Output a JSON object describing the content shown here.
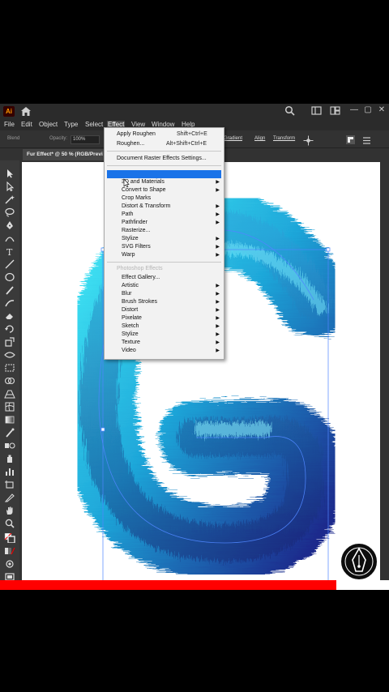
{
  "app": {
    "logo": "Ai",
    "window_controls": [
      "—",
      "▢",
      "✕"
    ]
  },
  "menubar": [
    "File",
    "Edit",
    "Object",
    "Type",
    "Select",
    "Effect",
    "View",
    "Window",
    "Help"
  ],
  "menubar_active": "Effect",
  "controlbar": {
    "style_label": "Blend",
    "opacity_label": "Opacity:",
    "opacity_value": "100%",
    "gradient_label": "Gradient",
    "align_label": "Align",
    "transform_label": "Transform"
  },
  "document_tab": "Fur Effect* @ 50 % (RGB/Previ",
  "effect_menu": {
    "apply_label": "Apply Roughen",
    "apply_shortcut": "Shift+Ctrl+E",
    "last_label": "Roughen...",
    "last_shortcut": "Alt+Shift+Ctrl+E",
    "raster_settings": "Document Raster Effects Settings...",
    "illustrator_items": [
      "3D and Materials",
      "Convert to Shape",
      "Crop Marks",
      "Distort & Transform",
      "Path",
      "Pathfinder",
      "Rasterize...",
      "Stylize",
      "SVG Filters",
      "Warp"
    ],
    "photoshop_header": "Photoshop Effects",
    "photoshop_items": [
      "Effect Gallery...",
      "Artistic",
      "Blur",
      "Brush Strokes",
      "Distort",
      "Pixelate",
      "Sketch",
      "Stylize",
      "Texture",
      "Video"
    ]
  },
  "video_progress": 0.865,
  "colors": {
    "accent_highlight": "#1a73e8",
    "fur_light": "#36d4ee",
    "fur_dark": "#1a2a8c",
    "progress": "#ff0000"
  }
}
